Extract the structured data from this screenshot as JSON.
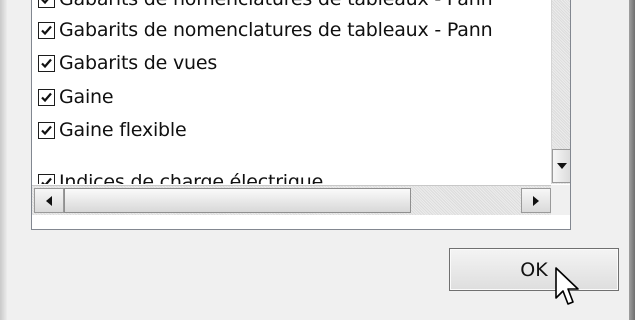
{
  "list": {
    "items": [
      {
        "label": "Gabarits de nomenclatures de tableaux - Pann",
        "checked": true
      },
      {
        "label": "Gabarits de nomenclatures de tableaux - Pann",
        "checked": true
      },
      {
        "label": "Gabarits de vues",
        "checked": true
      },
      {
        "label": "Gaine",
        "checked": true
      },
      {
        "label": "Gaine flexible",
        "checked": true
      },
      {
        "label": "Indices de charge électrique",
        "checked": true
      }
    ]
  },
  "icons": {
    "check": "check-icon",
    "scroll_down": "arrow-down-icon",
    "scroll_left": "arrow-left-icon",
    "scroll_right": "arrow-right-icon",
    "cursor": "mouse-pointer-icon"
  },
  "buttons": {
    "ok_label": "OK"
  }
}
